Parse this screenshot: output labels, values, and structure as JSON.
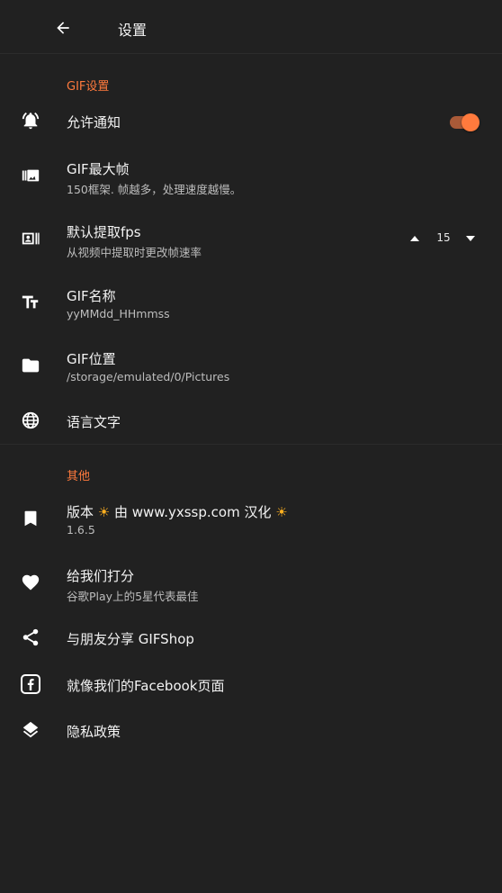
{
  "header": {
    "title": "设置",
    "back_icon": "arrow-left-icon"
  },
  "gif_section": {
    "title": "GIF设置",
    "items": [
      {
        "icon": "bell-icon",
        "title": "允许通知",
        "toggle_on": true
      },
      {
        "icon": "frames-icon",
        "title": "GIF最大帧",
        "subtitle": "150框架. 帧越多，处理速度越慢。"
      },
      {
        "icon": "fps-icon",
        "title": "默认提取fps",
        "subtitle": "从视频中提取时更改帧速率",
        "stepper_value": "15"
      },
      {
        "icon": "text-size-icon",
        "title": "GIF名称",
        "subtitle": "yyMMdd_HHmmss"
      },
      {
        "icon": "folder-icon",
        "title": "GIF位置",
        "subtitle": "/storage/emulated/0/Pictures"
      },
      {
        "icon": "globe-icon",
        "title": "语言文字"
      }
    ]
  },
  "other_section": {
    "title": "其他",
    "items": [
      {
        "icon": "bookmark-icon",
        "title_parts": [
          "版本 ",
          "☀",
          " 由 www.yxssp.com 汉化 ",
          "☀"
        ],
        "subtitle": "1.6.5"
      },
      {
        "icon": "heart-icon",
        "title": "给我们打分",
        "subtitle": "谷歌Play上的5星代表最佳"
      },
      {
        "icon": "share-icon",
        "title": "与朋友分享 GIFShop"
      },
      {
        "icon": "facebook-icon",
        "title": "就像我们的Facebook页面"
      },
      {
        "icon": "layers-icon",
        "title": "隐私政策"
      }
    ]
  },
  "colors": {
    "background": "#212121",
    "accent": "#ff7a3d",
    "text": "#f3f3f3",
    "subtext": "#bdbdbd"
  }
}
